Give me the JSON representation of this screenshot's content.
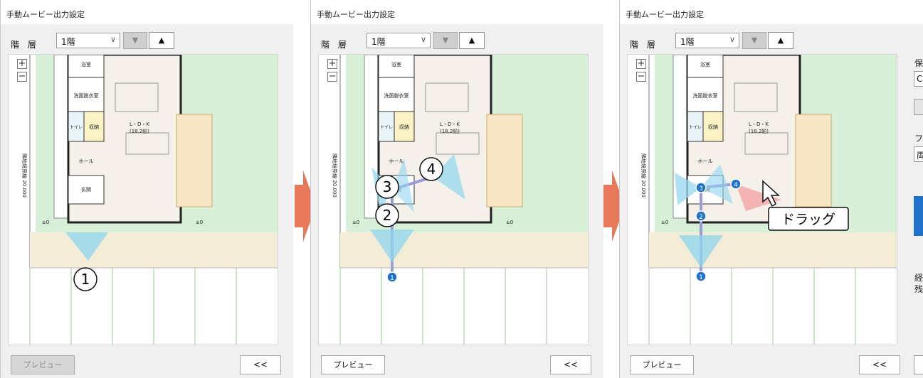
{
  "panels": [
    {
      "title": "手動ムービー出力設定",
      "floor_label": "階 層",
      "floor_value": "1階",
      "down_symbol": "▼",
      "up_symbol": "▲",
      "zoom_in": "+",
      "zoom_out": "−",
      "preview_label": "プレビュー",
      "preview_enabled": false,
      "collapse_label": "<<"
    },
    {
      "title": "手動ムービー出力設定",
      "floor_label": "階 層",
      "floor_value": "1階",
      "down_symbol": "▼",
      "up_symbol": "▲",
      "zoom_in": "+",
      "zoom_out": "−",
      "preview_label": "プレビュー",
      "preview_enabled": true,
      "collapse_label": "<<"
    },
    {
      "title": "手動ムービー出力設定",
      "floor_label": "階 層",
      "floor_value": "1階",
      "down_symbol": "▼",
      "up_symbol": "▲",
      "zoom_in": "+",
      "zoom_out": "−",
      "preview_label": "プレビュー",
      "preview_enabled": true,
      "collapse_label": "<<"
    }
  ],
  "floor_plan": {
    "rooms": {
      "bath": "浴室",
      "washroom": "洗面脱衣室",
      "toilet": "トイレ",
      "storage": "収納",
      "ldk": "L・D・K",
      "ldk_size": "(18.2帖)",
      "hall": "ホール",
      "entrance": "玄関"
    },
    "boundary_label": "隣地境界線 20.000",
    "level_mark": "±0"
  },
  "annotations": {
    "panel1": [
      "1"
    ],
    "panel2": [
      "2",
      "3",
      "4"
    ],
    "drag_label": "ドラッグ"
  },
  "camera_points": [
    "1",
    "2",
    "3",
    "4"
  ],
  "cutoff_labels": [
    "保",
    "C",
    "フ",
    "両",
    "経",
    "残"
  ],
  "colors": {
    "arrow": "#e8785a",
    "camera_cone": "#8fd6ee",
    "selected_cone": "#f2a9a9",
    "point": "#1e73c8",
    "path": "#9b9bd6",
    "lawn": "#d9f0d8",
    "accent_blue": "#1e73c8"
  }
}
